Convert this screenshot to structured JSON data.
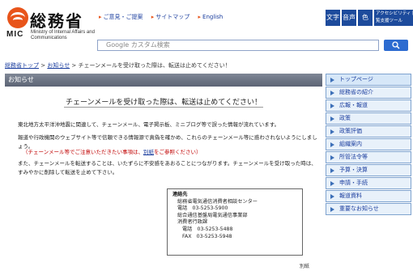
{
  "header": {
    "ministry_jp": "総務省",
    "ministry_en": "Ministry of Internal Affairs and Communications",
    "mic": "MIC",
    "toplinks": [
      "ご意見・ご提案",
      "サイトマップ",
      "English"
    ],
    "accessibility": {
      "box1": "文字",
      "box2": "音声",
      "box3": "色",
      "tool_label": "アクセシビリティ 閲覧支援ツール"
    },
    "search": {
      "placeholder": "Google カスタム検索",
      "button_icon": "search-icon"
    }
  },
  "breadcrumb": {
    "home": "総務省トップ",
    "sep1": " > ",
    "notices": "お知らせ",
    "sep2": " > ",
    "current": "チェーンメールを受け取った際は、転送は止めてください！"
  },
  "section_title": "お知らせ",
  "notice": {
    "title": "チェーンメールを受け取った際は、転送は止めてください！",
    "p1": "東北地方太平洋沖地震に関連して、チェーンメール、電子掲示板、ミニブログ等で誤った情報が流れています。",
    "p2": "報道や行政機関のウェブサイト等で信頼できる情報源で真偽を確かめ、これらのチェーンメール等に惑わされないようにしましょう。",
    "p2_red_before": "（チェーンメール等でご注意いただきたい事項は、",
    "p2_red_link": "別紙",
    "p2_red_after": "をご参照ください）",
    "p3": "また、チェーンメールを転送することは、いたずらに不安感をあおることにつながります。チェーンメールを受け取った時は、すみやかに削除して転送を止めて下さい。"
  },
  "contact": {
    "title": "連絡先",
    "line1": "総務省電気通信消費者相談センター",
    "line2": "電話　03-5253-5900",
    "line3": "総合通信基盤局電気通信事業部",
    "line4": "消費者行政課",
    "line5": "電話　03-5253-5488",
    "line6": "FAX　03-5253-5948"
  },
  "betsushi": "別紙",
  "sidebar": {
    "items": [
      "トップページ",
      "総務省の紹介",
      "広報・報道",
      "政策",
      "政策評価",
      "組織案内",
      "所管法令等",
      "予算・決算",
      "申請・手続",
      "報道資料",
      "重要なお知らせ"
    ]
  },
  "colors": {
    "brand_orange": "#e8541a",
    "link_blue": "#1a3d9e",
    "section_bar": "#6b7383",
    "warning_red": "#c00000"
  }
}
